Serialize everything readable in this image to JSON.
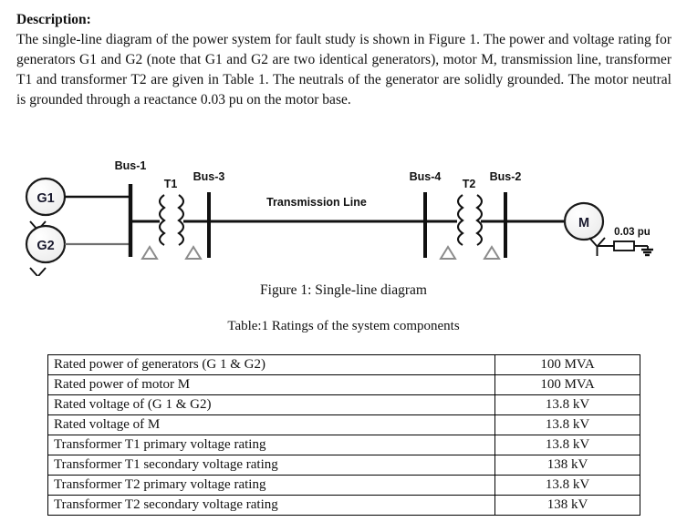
{
  "description": {
    "heading": "Description:",
    "body": "The single-line diagram of the power system for fault study is shown in Figure 1. The power and voltage rating for generators G1 and G2 (note that G1 and G2 are two identical generators), motor M, transmission line, transformer T1 and transformer T2 are given in Table 1. The neutrals of the generator are solidly grounded. The motor neutral is grounded through a reactance 0.03 pu on the motor base."
  },
  "diagram": {
    "generators": [
      {
        "label": "G1"
      },
      {
        "label": "G2"
      }
    ],
    "motor": {
      "label": "M"
    },
    "buses": [
      {
        "label": "Bus-1"
      },
      {
        "label": "Bus-3"
      },
      {
        "label": "Bus-4"
      },
      {
        "label": "Bus-2"
      }
    ],
    "transformers": [
      {
        "label": "T1"
      },
      {
        "label": "T2"
      }
    ],
    "line_label": "Transmission Line",
    "reactance_label": "0.03 pu"
  },
  "figure_caption": "Figure 1: Single-line diagram",
  "table_caption": "Table:1 Ratings of the system components",
  "table": {
    "rows": [
      {
        "item": "Rated power of generators (G 1 & G2)",
        "value": "100 MVA"
      },
      {
        "item": "Rated power of motor M",
        "value": "100 MVA"
      },
      {
        "item": "Rated voltage of (G 1 & G2)",
        "value": "13.8 kV"
      },
      {
        "item": "Rated voltage of M",
        "value": "13.8 kV"
      },
      {
        "item": "Transformer T1 primary voltage rating",
        "value": "13.8 kV"
      },
      {
        "item": "Transformer T1 secondary voltage rating",
        "value": "138 kV"
      },
      {
        "item": "Transformer T2 primary voltage rating",
        "value": "13.8 kV"
      },
      {
        "item": "Transformer T2 secondary voltage rating",
        "value": "138 kV"
      }
    ]
  },
  "colors": {
    "ink": "#111111",
    "paper": "#ffffff",
    "symbol_fill": "#f2f2f2",
    "symbol_stroke": "#1a1a1a",
    "delta_stroke": "#8c8c8c"
  }
}
